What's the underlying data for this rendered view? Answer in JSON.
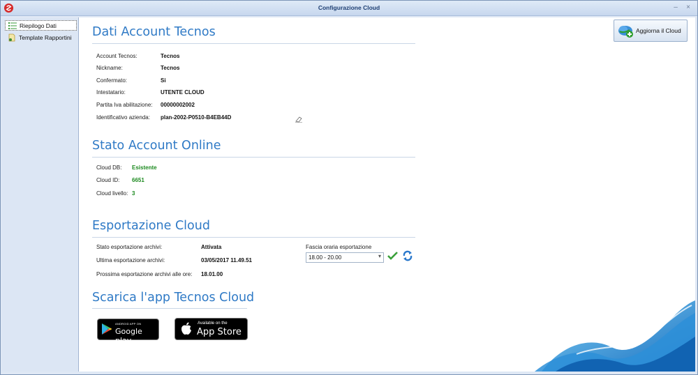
{
  "window": {
    "title": "Configurazione Cloud",
    "minimize": "–",
    "close": "×"
  },
  "sidebar": {
    "items": [
      {
        "label": "Riepilogo Dati"
      },
      {
        "label": "Template Rapportini"
      }
    ]
  },
  "toolbar": {
    "update_label": "Aggiorna il Cloud"
  },
  "account": {
    "title": "Dati Account Tecnos",
    "rows": [
      {
        "label": "Account Tecnos:",
        "value": "Tecnos"
      },
      {
        "label": "Nickname:",
        "value": "Tecnos"
      },
      {
        "label": "Confermato:",
        "value": "Si"
      },
      {
        "label": "Intestatario:",
        "value": "UTENTE CLOUD"
      },
      {
        "label": "Partita Iva abilitazione:",
        "value": "00000002002"
      },
      {
        "label": "Identificativo azienda:",
        "value": "plan-2002-P0510-B4EB44D"
      }
    ]
  },
  "online": {
    "title": "Stato Account Online",
    "rows": [
      {
        "label": "Cloud DB:",
        "value": "Esistente"
      },
      {
        "label": "Cloud ID:",
        "value": "6651"
      },
      {
        "label": "Cloud livello:",
        "value": "3"
      }
    ]
  },
  "export": {
    "title": "Esportazione Cloud",
    "rows": [
      {
        "label": "Stato esportazione archivi:",
        "value": "Attivata"
      },
      {
        "label": "Ultima esportazione archivi:",
        "value": "03/05/2017 11.49.51"
      },
      {
        "label": "Prossima esportazione archivi alle ore:",
        "value": "18.01.00"
      }
    ],
    "time_slot_label": "Fascia oraria esportazione",
    "time_slot_value": "18.00 - 20.00"
  },
  "app": {
    "title": "Scarica l'app Tecnos Cloud",
    "google": {
      "small": "ANDROID APP ON",
      "big": "Google play"
    },
    "apple": {
      "small": "Available on the",
      "big": "App Store"
    }
  },
  "colors": {
    "accent": "#2f7ac6",
    "green": "#1d8a20"
  }
}
